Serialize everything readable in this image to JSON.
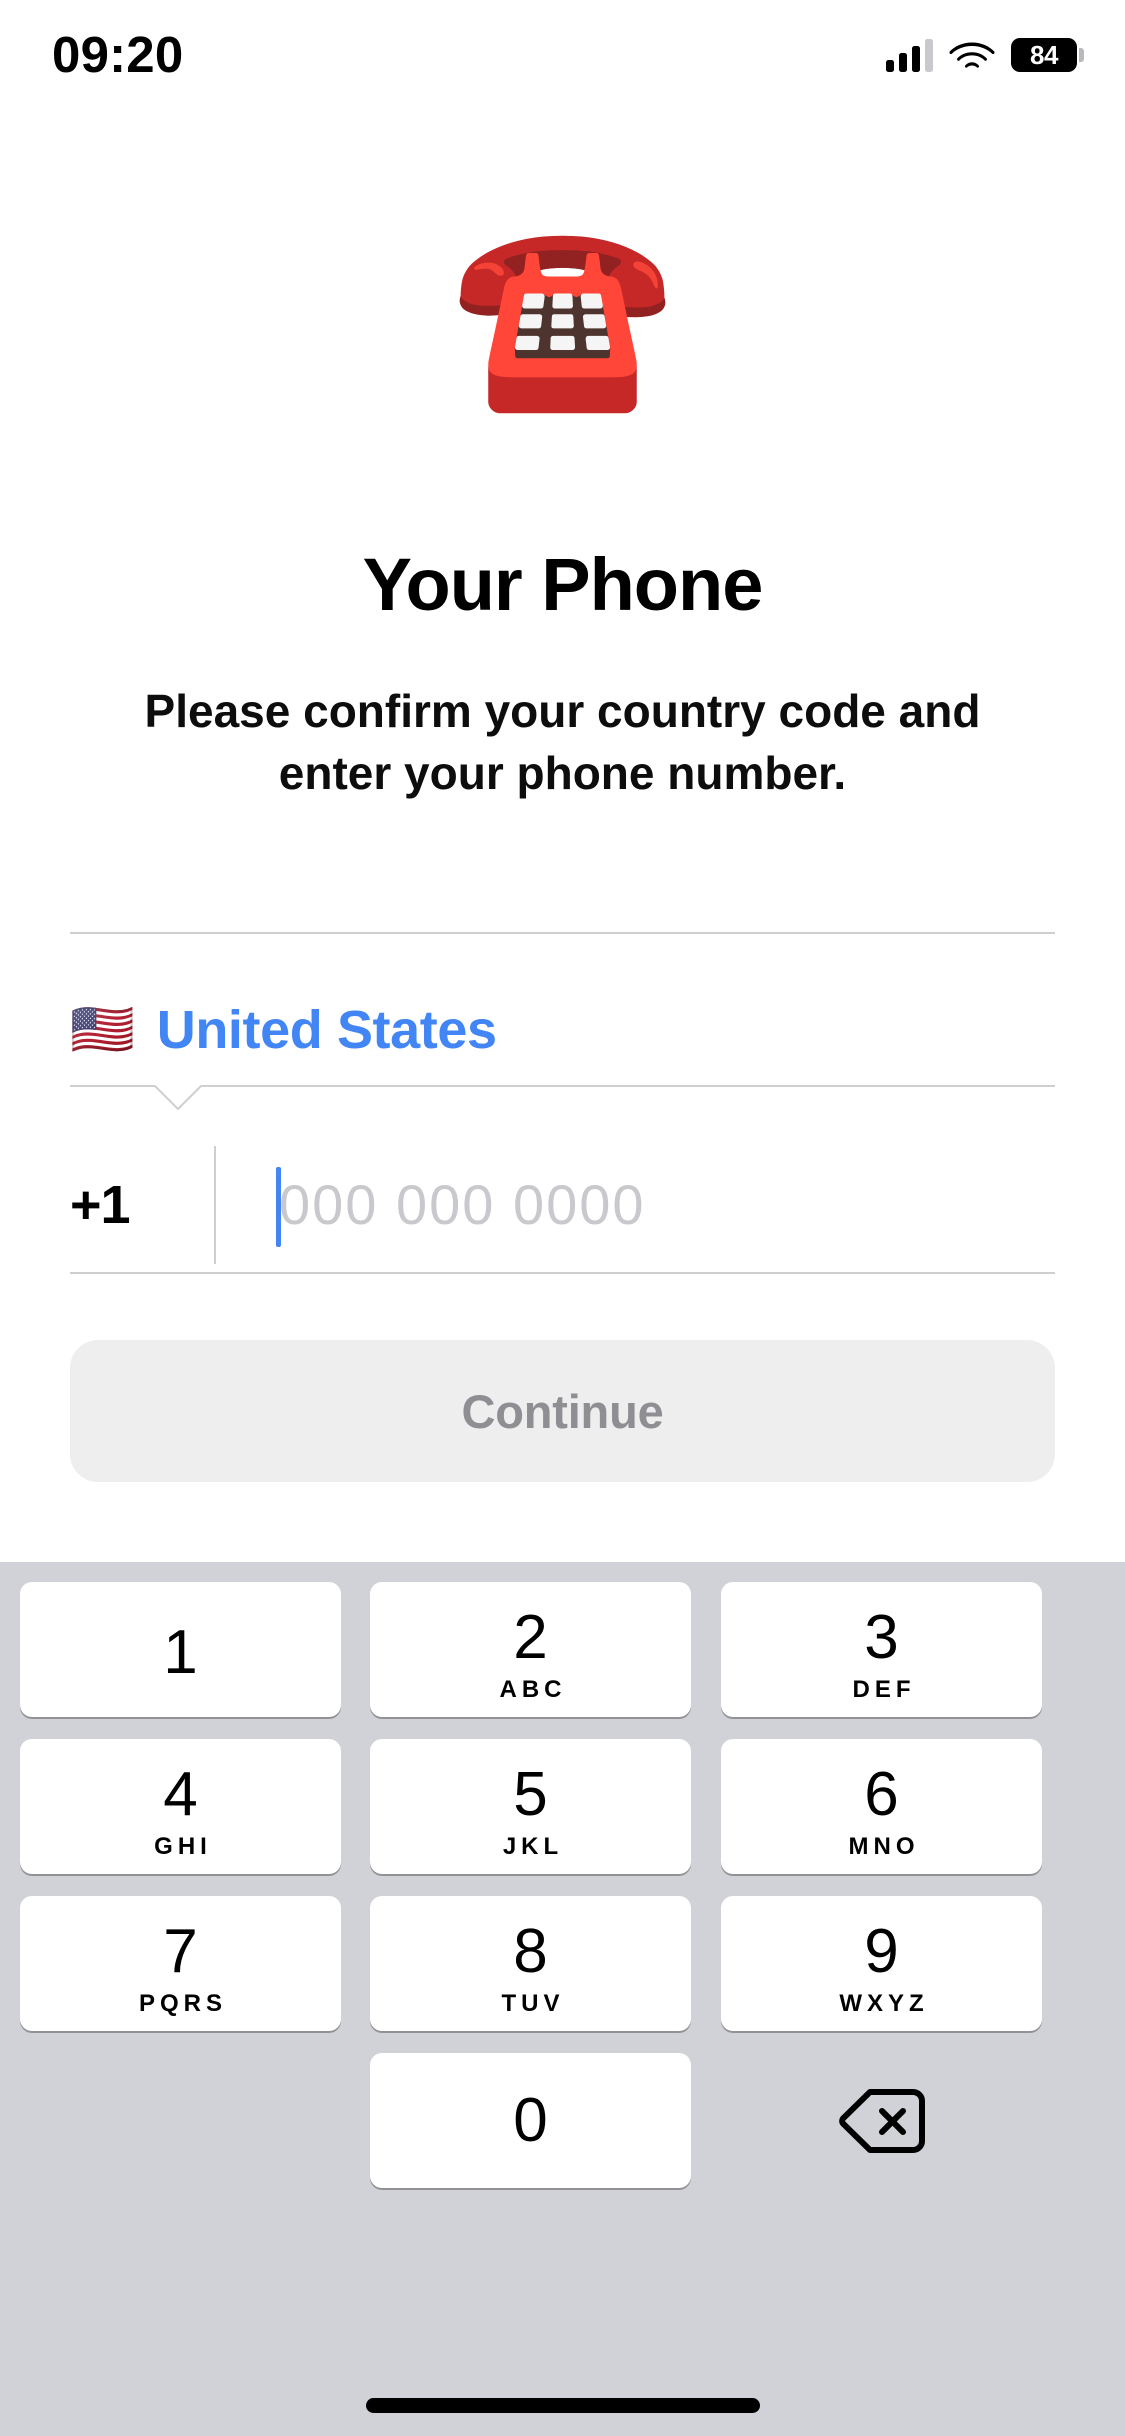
{
  "status_bar": {
    "time": "09:20",
    "cellular_icon": "signal-bars-icon",
    "wifi_icon": "wifi-icon",
    "battery_icon": "battery-icon",
    "battery_level": "84"
  },
  "hero": {
    "emoji_icon": "telephone-emoji",
    "emoji": "☎️",
    "title": "Your Phone",
    "subtitle": "Please confirm your country code and enter your phone number."
  },
  "form": {
    "country": {
      "flag_icon": "flag-united-states-emoji",
      "flag": "🇺🇸",
      "name": "United States"
    },
    "phone": {
      "country_code": "+1",
      "value": "",
      "placeholder": "000 000 0000"
    },
    "submit_label": "Continue"
  },
  "colors": {
    "accent_blue": "#4285f4",
    "divider": "#cfcfd2",
    "button_bg": "#eeeeef",
    "button_text": "#8e8e93",
    "keypad_bg": "#d1d2d7",
    "key_bg": "#ffffff",
    "placeholder": "#c9c9cd"
  },
  "keypad": {
    "keys": [
      {
        "digit": "1",
        "letters": ""
      },
      {
        "digit": "2",
        "letters": "ABC"
      },
      {
        "digit": "3",
        "letters": "DEF"
      },
      {
        "digit": "4",
        "letters": "GHI"
      },
      {
        "digit": "5",
        "letters": "JKL"
      },
      {
        "digit": "6",
        "letters": "MNO"
      },
      {
        "digit": "7",
        "letters": "PQRS"
      },
      {
        "digit": "8",
        "letters": "TUV"
      },
      {
        "digit": "9",
        "letters": "WXYZ"
      },
      {
        "digit": "0",
        "letters": ""
      }
    ],
    "backspace_icon": "backspace-delete-icon"
  }
}
